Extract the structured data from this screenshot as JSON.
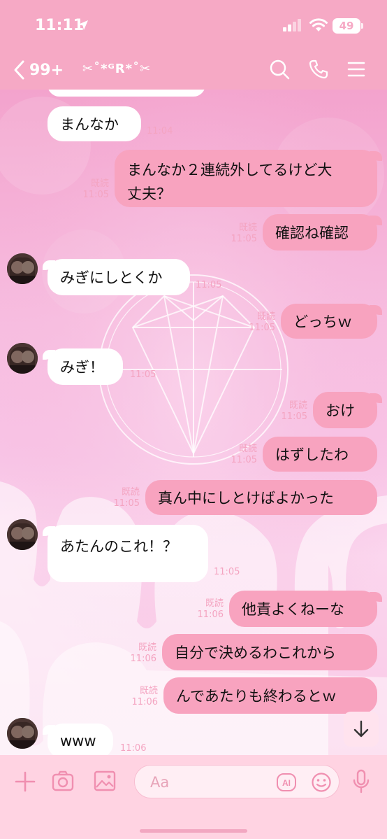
{
  "status": {
    "time": "11:11",
    "battery": "49"
  },
  "header": {
    "back_count": "99+",
    "chat_name": "✂˚*ᴳR*˚✂"
  },
  "messages": [
    {
      "side": "recv",
      "text": "まんなか",
      "time": "11:04"
    },
    {
      "side": "sent",
      "text": "まんなか２連続外してるけど大丈夫？",
      "line1": "まんなか２連続外してるけど大",
      "line2": "丈夫？",
      "read": "既読",
      "time": "11:05"
    },
    {
      "side": "sent",
      "text": "確認ね確認",
      "read": "既読",
      "time": "11:05"
    },
    {
      "side": "recv",
      "text": "みぎにしとくか",
      "time": "11:05"
    },
    {
      "side": "sent",
      "text": "どっちｗ",
      "read": "既読",
      "time": "11:05"
    },
    {
      "side": "recv",
      "text": "みぎ！",
      "time": "11:05"
    },
    {
      "side": "sent",
      "text": "おけ",
      "read": "既読",
      "time": "11:05"
    },
    {
      "side": "sent",
      "text": "はずしたわ",
      "read": "既読",
      "time": "11:05"
    },
    {
      "side": "sent",
      "text": "真ん中にしとけばよかった",
      "read": "既読",
      "time": "11:05"
    },
    {
      "side": "recv",
      "text": "あたんのこれ！？",
      "time": "11:05"
    },
    {
      "side": "sent",
      "text": "他責よくねーな",
      "read": "既読",
      "time": "11:06"
    },
    {
      "side": "sent",
      "text": "自分で決めるわこれから",
      "read": "既読",
      "time": "11:06"
    },
    {
      "side": "sent",
      "text": "んであたりも終わるとｗ",
      "read": "既読",
      "time": "11:06"
    },
    {
      "side": "recv",
      "text": "www",
      "time": "11:06"
    }
  ],
  "input": {
    "placeholder": "Aa"
  },
  "colors": {
    "header": "#f6a9c5",
    "sent_bubble": "#f8a3bf",
    "recv_bubble": "#ffffff",
    "input_bar": "#ffd3e2"
  },
  "icons": [
    "location-arrow-icon",
    "signal-icon",
    "wifi-icon",
    "back-chevron-icon",
    "search-icon",
    "phone-icon",
    "menu-icon",
    "plus-icon",
    "camera-icon",
    "image-icon",
    "ai-icon",
    "emoji-icon",
    "microphone-icon",
    "scroll-down-icon"
  ]
}
